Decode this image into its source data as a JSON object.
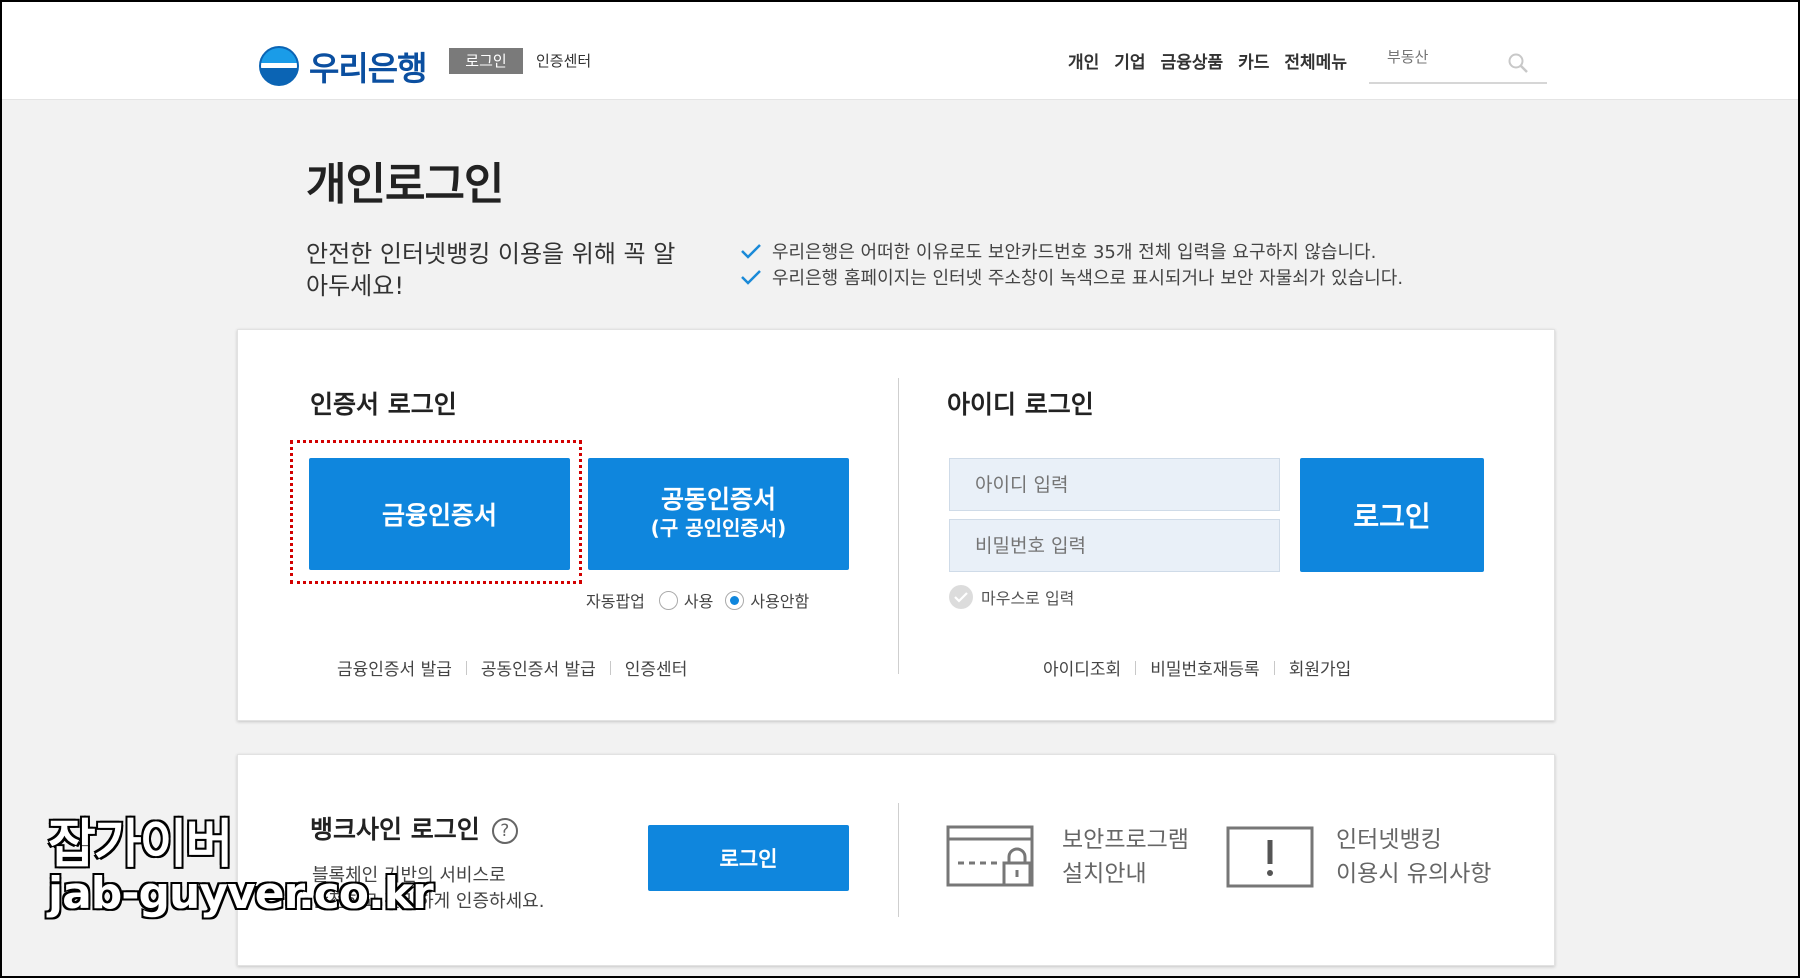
{
  "header": {
    "logo_text": "우리은행",
    "login_label": "로그인",
    "cert_center": "인증센터",
    "gnb": [
      "개인",
      "기업",
      "금융상품",
      "카드",
      "전체메뉴"
    ],
    "search_placeholder": "부동산"
  },
  "page": {
    "title": "개인로그인",
    "notice_title": "안전한 인터넷뱅킹 이용을 위해 꼭 알아두세요!",
    "notices": [
      "우리은행은 어떠한 이유로도 보안카드번호 35개 전체 입력을 요구하지 않습니다.",
      "우리은행 홈페이지는 인터넷 주소창이 녹색으로 표시되거나 보안 자물쇠가 있습니다."
    ]
  },
  "cert_login": {
    "title": "인증서 로그인",
    "financial_cert_label": "금융인증서",
    "joint_cert_label": "공동인증서",
    "joint_cert_sub": "(구 공인인증서)",
    "popup_label": "자동팝업",
    "popup_on": "사용",
    "popup_off": "사용안함",
    "popup_selected": "사용안함",
    "links": [
      "금융인증서 발급",
      "공동인증서 발급",
      "인증센터"
    ]
  },
  "id_login": {
    "title": "아이디 로그인",
    "id_placeholder": "아이디 입력",
    "pw_placeholder": "비밀번호 입력",
    "login_label": "로그인",
    "mouse_input": "마우스로 입력",
    "links": [
      "아이디조회",
      "비밀번호재등록",
      "회원가입"
    ]
  },
  "bank_sign": {
    "title": "뱅크사인 로그인",
    "help": "?",
    "desc_line1": "블록체인 기반의 서비스로",
    "desc_line2": "안전하고 편리하게 인증하세요.",
    "login_label": "로그인"
  },
  "tools": [
    {
      "line1": "보안프로그램",
      "line2": "설치안내",
      "icon": "security-card-lock-icon"
    },
    {
      "line1": "인터넷뱅킹",
      "line2": "이용시 유의사항",
      "icon": "warning-box-icon"
    }
  ],
  "watermark": {
    "line1": "잡가이버",
    "line2": "jab-guyver.co.kr"
  },
  "colors": {
    "brand_blue": "#0f86dd",
    "logo_navy": "#0b4fa0",
    "highlight_red": "#d20000",
    "field_bg": "#e9f0f8"
  }
}
